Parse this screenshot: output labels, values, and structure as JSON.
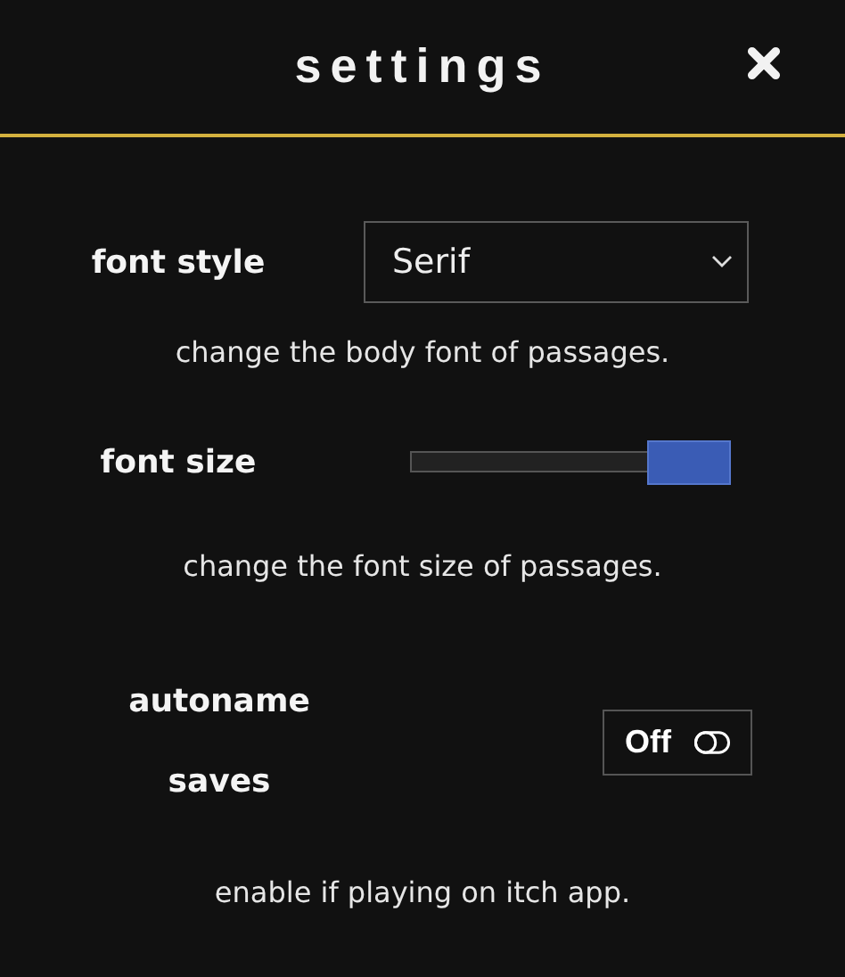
{
  "title": "settings",
  "settings": [
    {
      "kind": "select",
      "label": "font style",
      "value": "Serif",
      "description": "change the body font of passages."
    },
    {
      "kind": "slider",
      "label": "font size",
      "level": 1,
      "description": "change the font size of passages."
    },
    {
      "kind": "toggle",
      "label": "autoname saves",
      "on": false,
      "state_text": "Off",
      "description": "enable if playing on itch app."
    }
  ]
}
